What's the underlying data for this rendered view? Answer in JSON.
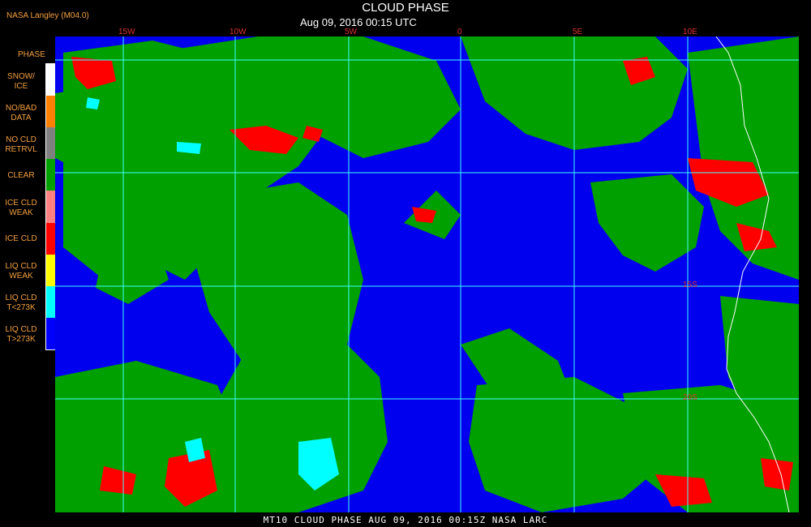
{
  "header": {
    "org": "NASA Langley (M04.0)",
    "title": "CLOUD PHASE",
    "datetime": "Aug 09, 2016 00:15 UTC"
  },
  "legend": {
    "title": "PHASE",
    "items": [
      {
        "label": "SNOW/\nICE",
        "color": "#ffffff"
      },
      {
        "label": "NO/BAD\nDATA",
        "color": "#ff8000"
      },
      {
        "label": "NO CLD\nRETRVL",
        "color": "#808080"
      },
      {
        "label": "CLEAR",
        "color": "#00a000"
      },
      {
        "label": "ICE CLD\nWEAK",
        "color": "#ff8080"
      },
      {
        "label": "ICE CLD",
        "color": "#ff0000"
      },
      {
        "label": "LIQ CLD\nWEAK",
        "color": "#ffff00"
      },
      {
        "label": "LIQ CLD\nT<273K",
        "color": "#00ffff"
      },
      {
        "label": "LIQ CLD\nT>273K",
        "color": "#0000ff"
      }
    ]
  },
  "map": {
    "lon_labels": [
      "15W",
      "10W",
      "5W",
      "0",
      "5E",
      "10E"
    ],
    "lat_labels": [
      "15S",
      "20S"
    ],
    "grid_color": "#40ffff",
    "coastline_color": "#ffffff"
  },
  "footer": "MT10  CLOUD PHASE  AUG 09, 2016 00:15Z  NASA LARC"
}
